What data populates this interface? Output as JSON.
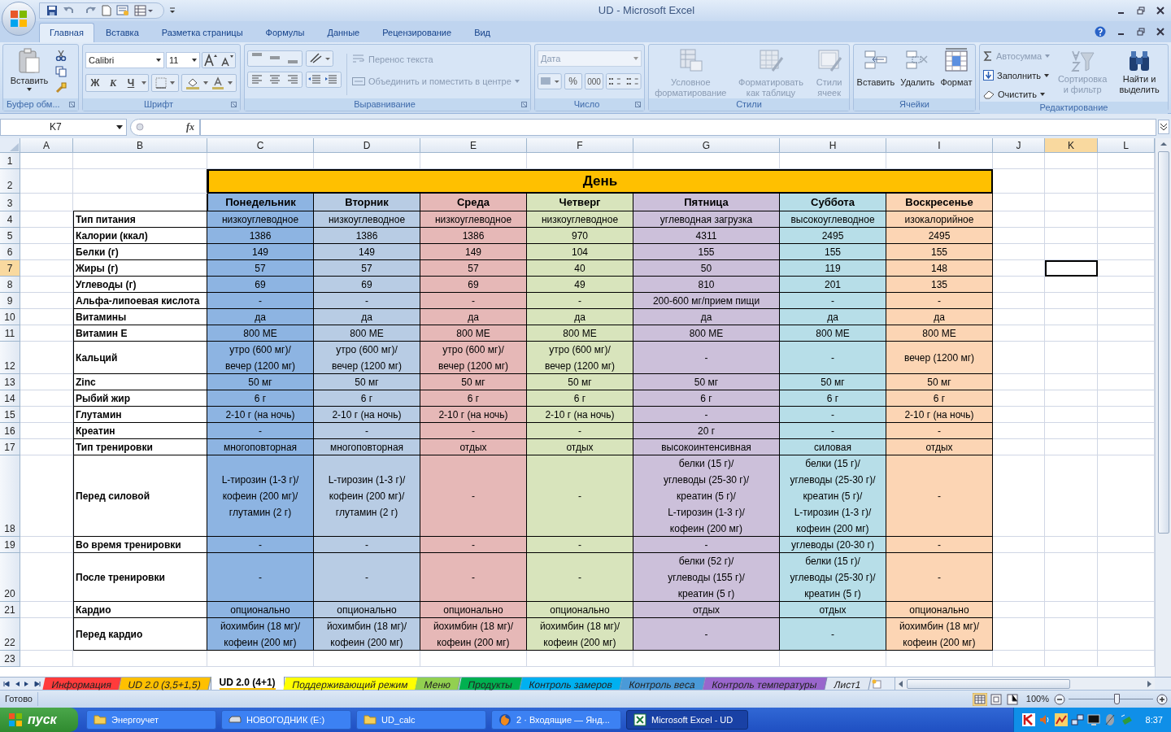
{
  "window": {
    "title": "UD - Microsoft Excel"
  },
  "tabs": [
    {
      "label": "Главная",
      "selected": true
    },
    {
      "label": "Вставка",
      "selected": false
    },
    {
      "label": "Разметка страницы",
      "selected": false
    },
    {
      "label": "Формулы",
      "selected": false
    },
    {
      "label": "Данные",
      "selected": false
    },
    {
      "label": "Рецензирование",
      "selected": false
    },
    {
      "label": "Вид",
      "selected": false
    }
  ],
  "ribbon": {
    "clipboard": {
      "label": "Буфер обм...",
      "paste": "Вставить"
    },
    "font": {
      "label": "Шрифт",
      "name": "Calibri",
      "size": "11",
      "bold": "Ж",
      "italic": "К",
      "underline": "Ч"
    },
    "alignment": {
      "label": "Выравнивание",
      "wrap": {
        "label": "Перенос текста",
        "disabled": true
      },
      "merge": {
        "label": "Объединить и поместить в центре",
        "disabled": true
      }
    },
    "number": {
      "label": "Число",
      "format": {
        "label": "Дата",
        "disabled": true
      },
      "percent": "%",
      "thousands": "000"
    },
    "styles": {
      "label": "Стили",
      "buttons": [
        {
          "label": "Условное форматирование",
          "disabled": true
        },
        {
          "label": "Форматировать как таблицу",
          "disabled": true
        },
        {
          "label": "Стили ячеек",
          "disabled": true
        }
      ]
    },
    "cells": {
      "label": "Ячейки",
      "buttons": [
        {
          "label": "Вставить",
          "disabled": false
        },
        {
          "label": "Удалить",
          "disabled": false
        },
        {
          "label": "Формат",
          "disabled": false
        }
      ]
    },
    "editing": {
      "label": "Редактирование",
      "autosum": {
        "label": "Автосумма",
        "disabled": true
      },
      "fill": {
        "label": "Заполнить",
        "disabled": false
      },
      "clear": {
        "label": "Очистить",
        "disabled": false
      },
      "sort": {
        "label": "Сортировка и фильтр",
        "disabled": true
      },
      "find": {
        "label": "Найти и выделить",
        "disabled": false
      }
    }
  },
  "formula_bar": {
    "name_box": "K7",
    "function_label": "fx"
  },
  "columns": [
    {
      "label": "A",
      "selected": false
    },
    {
      "label": "B",
      "selected": false
    },
    {
      "label": "C",
      "selected": false
    },
    {
      "label": "D",
      "selected": false
    },
    {
      "label": "E",
      "selected": false
    },
    {
      "label": "F",
      "selected": false
    },
    {
      "label": "G",
      "selected": false
    },
    {
      "label": "H",
      "selected": false
    },
    {
      "label": "I",
      "selected": false
    },
    {
      "label": "J",
      "selected": false
    },
    {
      "label": "K",
      "selected": true
    },
    {
      "label": "L",
      "selected": false
    }
  ],
  "row_numbers": [
    {
      "label": "1",
      "selected": false
    },
    {
      "label": "2",
      "selected": false
    },
    {
      "label": "3",
      "selected": false
    },
    {
      "label": "4",
      "selected": false
    },
    {
      "label": "5",
      "selected": false
    },
    {
      "label": "6",
      "selected": false
    },
    {
      "label": "7",
      "selected": true
    },
    {
      "label": "8",
      "selected": false
    },
    {
      "label": "9",
      "selected": false
    },
    {
      "label": "10",
      "selected": false
    },
    {
      "label": "11",
      "selected": false
    },
    {
      "label": "12",
      "selected": false
    },
    {
      "label": "13",
      "selected": false
    },
    {
      "label": "14",
      "selected": false
    },
    {
      "label": "15",
      "selected": false
    },
    {
      "label": "16",
      "selected": false
    },
    {
      "label": "17",
      "selected": false
    },
    {
      "label": "18",
      "selected": false
    },
    {
      "label": "19",
      "selected": false
    },
    {
      "label": "20",
      "selected": false
    },
    {
      "label": "21",
      "selected": false
    },
    {
      "label": "22",
      "selected": false
    },
    {
      "label": "23",
      "selected": false
    }
  ],
  "table": {
    "title": "День",
    "days": [
      {
        "label": "Понедельник",
        "color": "#8db4e2"
      },
      {
        "label": "Вторник",
        "color": "#b8cce4"
      },
      {
        "label": "Среда",
        "color": "#e6b8b7"
      },
      {
        "label": "Четверг",
        "color": "#d8e4bc"
      },
      {
        "label": "Пятница",
        "color": "#ccc0da"
      },
      {
        "label": "Суббота",
        "color": "#b7dee8"
      },
      {
        "label": "Воскресенье",
        "color": "#fcd5b4"
      }
    ],
    "rows": [
      {
        "label": "Тип питания",
        "cells": [
          "низкоуглеводное",
          "низкоуглеводное",
          "низкоуглеводное",
          "низкоуглеводное",
          "углеводная загрузка",
          "высокоуглеводное",
          "изокалорийное"
        ]
      },
      {
        "label": "Калории (ккал)",
        "cells": [
          "1386",
          "1386",
          "1386",
          "970",
          "4311",
          "2495",
          "2495"
        ]
      },
      {
        "label": "Белки (г)",
        "cells": [
          "149",
          "149",
          "149",
          "104",
          "155",
          "155",
          "155"
        ]
      },
      {
        "label": "Жиры (г)",
        "cells": [
          "57",
          "57",
          "57",
          "40",
          "50",
          "119",
          "148"
        ]
      },
      {
        "label": "Углеводы (г)",
        "cells": [
          "69",
          "69",
          "69",
          "49",
          "810",
          "201",
          "135"
        ]
      },
      {
        "label": "Альфа-липоевая кислота",
        "cells": [
          "-",
          "-",
          "-",
          "-",
          "200-600 мг/прием пищи",
          "-",
          "-"
        ]
      },
      {
        "label": "Витамины",
        "cells": [
          "да",
          "да",
          "да",
          "да",
          "да",
          "да",
          "да"
        ]
      },
      {
        "label": "Витамин Е",
        "cells": [
          "800 МЕ",
          "800 МЕ",
          "800 МЕ",
          "800 МЕ",
          "800 МЕ",
          "800 МЕ",
          "800 МЕ"
        ]
      },
      {
        "label": "Кальций",
        "cells": [
          "утро (600 мг)/\nвечер (1200 мг)",
          "утро (600 мг)/\nвечер (1200 мг)",
          "утро (600 мг)/\nвечер (1200 мг)",
          "утро (600 мг)/\nвечер (1200 мг)",
          "-",
          "-",
          "вечер (1200 мг)"
        ]
      },
      {
        "label": "Zinc",
        "cells": [
          "50 мг",
          "50 мг",
          "50 мг",
          "50 мг",
          "50 мг",
          "50 мг",
          "50 мг"
        ]
      },
      {
        "label": "Рыбий жир",
        "cells": [
          "6 г",
          "6 г",
          "6 г",
          "6 г",
          "6 г",
          "6 г",
          "6 г"
        ]
      },
      {
        "label": "Глутамин",
        "cells": [
          "2-10 г (на ночь)",
          "2-10 г (на ночь)",
          "2-10 г (на ночь)",
          "2-10 г (на ночь)",
          "-",
          "-",
          "2-10 г (на ночь)"
        ]
      },
      {
        "label": "Креатин",
        "cells": [
          "-",
          "-",
          "-",
          "-",
          "20 г",
          "-",
          "-"
        ]
      },
      {
        "label": "Тип тренировки",
        "cells": [
          "многоповторная",
          "многоповторная",
          "отдых",
          "отдых",
          "высокоинтенсивная",
          "силовая",
          "отдых"
        ]
      },
      {
        "label": "Перед силовой",
        "cells": [
          "L-тирозин (1-3 г)/\nкофеин (200 мг)/\nглутамин (2 г)",
          "L-тирозин (1-3 г)/\nкофеин (200 мг)/\nглутамин (2 г)",
          "-",
          "-",
          "белки (15 г)/\nуглеводы (25-30 г)/\nкреатин (5 г)/\nL-тирозин (1-3 г)/\nкофеин (200 мг)",
          "белки (15 г)/\nуглеводы (25-30 г)/\nкреатин (5 г)/\nL-тирозин (1-3 г)/\nкофеин (200 мг)",
          "-"
        ]
      },
      {
        "label": "Во время тренировки",
        "cells": [
          "-",
          "-",
          "-",
          "-",
          "-",
          "углеводы (20-30 г)",
          "-"
        ]
      },
      {
        "label": "После тренировки",
        "cells": [
          "-",
          "-",
          "-",
          "-",
          "белки (52 г)/\nуглеводы (155 г)/\nкреатин (5 г)",
          "белки (15 г)/\nуглеводы (25-30 г)/\nкреатин (5 г)",
          "-"
        ]
      },
      {
        "label": "Кардио",
        "cells": [
          "опционально",
          "опционально",
          "опционально",
          "опционально",
          "отдых",
          "отдых",
          "опционально"
        ]
      },
      {
        "label": "Перед кардио",
        "cells": [
          "йохимбин (18 мг)/\nкофеин (200 мг)",
          "йохимбин (18 мг)/\nкофеин (200 мг)",
          "йохимбин (18 мг)/\nкофеин (200 мг)",
          "йохимбин (18 мг)/\nкофеин (200 мг)",
          "-",
          "-",
          "йохимбин (18 мг)/\nкофеин (200 мг)"
        ]
      }
    ]
  },
  "sheet_tabs": [
    {
      "label": "Информация",
      "color": "#ff3b3b",
      "selected": false
    },
    {
      "label": "UD 2.0 (3,5+1,5)",
      "color": "#ffc000",
      "selected": false
    },
    {
      "label": "UD 2.0 (4+1)",
      "color": "#ffc000",
      "selected": true
    },
    {
      "label": "Поддерживающий режим",
      "color": "#ffff00",
      "selected": false
    },
    {
      "label": "Меню",
      "color": "#92d050",
      "selected": false
    },
    {
      "label": "Продукты",
      "color": "#00b050",
      "selected": false
    },
    {
      "label": "Контроль замеров",
      "color": "#00b0f0",
      "selected": false
    },
    {
      "label": "Контроль веса",
      "color": "#4a9ad8",
      "selected": false
    },
    {
      "label": "Контроль температуры",
      "color": "#9966cc",
      "selected": false
    },
    {
      "label": "Лист1",
      "selected": false
    }
  ],
  "status_bar": {
    "status": "Готово",
    "zoom": "100%"
  },
  "taskbar": {
    "start": "пуск",
    "items": [
      {
        "label": "Энергоучет",
        "kind": "folder",
        "active": false
      },
      {
        "label": "НОВОГОДНИК (E:)",
        "kind": "drive",
        "active": false
      },
      {
        "label": "UD_calc",
        "kind": "folder",
        "active": false
      },
      {
        "label": "2 · Входящие — Янд...",
        "kind": "browser",
        "active": false
      },
      {
        "label": "Microsoft Excel - UD",
        "kind": "excel",
        "active": true
      }
    ],
    "clock": "8:37"
  }
}
